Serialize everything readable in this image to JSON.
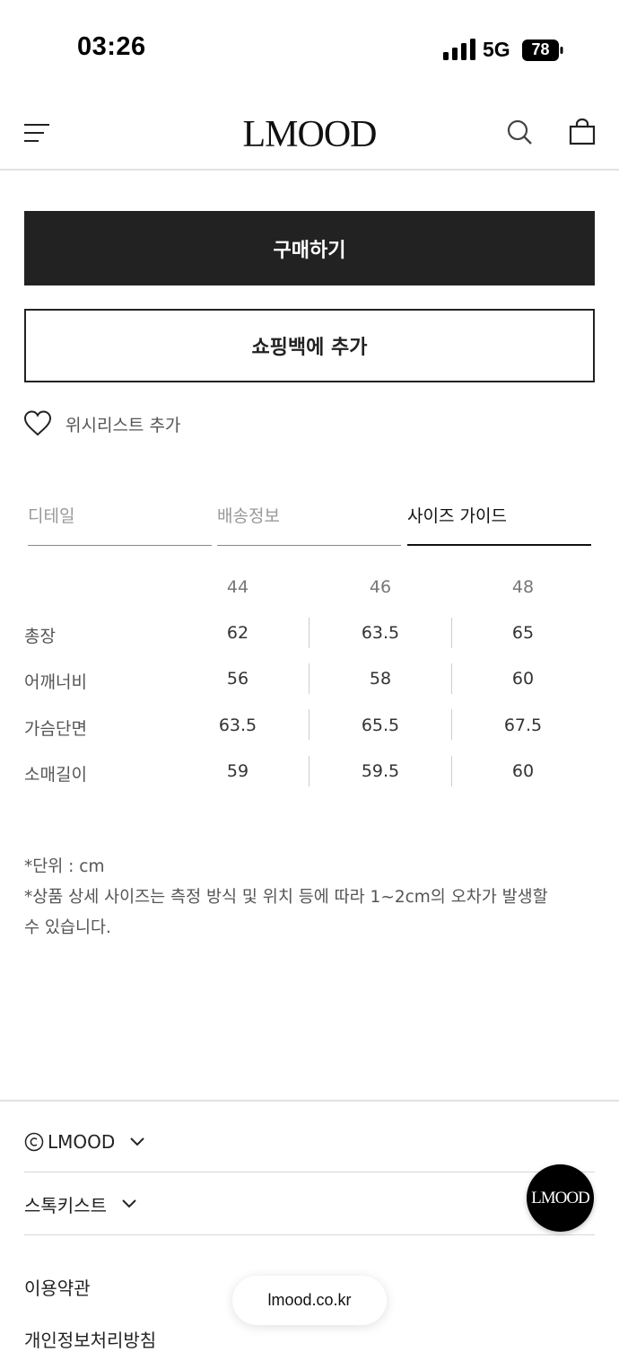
{
  "status_bar": {
    "time": "03:26",
    "network": "5G",
    "battery": "78"
  },
  "header": {
    "logo": "LMOOD",
    "menu_icon": "hamburger-menu-icon",
    "search_icon": "search-icon",
    "bag_icon": "shopping-bag-icon"
  },
  "actions": {
    "buy_label": "구매하기",
    "add_to_bag_label": "쇼핑백에 추가",
    "wishlist_label": "위시리스트 추가",
    "wishlist_icon": "heart-icon"
  },
  "tabs": [
    {
      "label": "디테일",
      "active": false
    },
    {
      "label": "배송정보",
      "active": false
    },
    {
      "label": "사이즈 가이드",
      "active": true
    }
  ],
  "size_table": {
    "sizes": [
      "44",
      "46",
      "48"
    ],
    "rows": [
      {
        "label": "총장",
        "values": [
          "62",
          "63.5",
          "65"
        ]
      },
      {
        "label": "어깨너비",
        "values": [
          "56",
          "58",
          "60"
        ]
      },
      {
        "label": "가슴단면",
        "values": [
          "63.5",
          "65.5",
          "67.5"
        ]
      },
      {
        "label": "소매길이",
        "values": [
          "59",
          "59.5",
          "60"
        ]
      }
    ]
  },
  "notes": {
    "unit": "*단위 : cm",
    "disclaimer_line1": "*상품 상세 사이즈는 측정 방식 및 위치 등에 따라 1~2cm의 오차가 발생할",
    "disclaimer_line2": "수 있습니다."
  },
  "footer": {
    "copyright_label": "LMOOD",
    "copyright_icon": "copyright-icon",
    "stockist_label": "스톡키스트",
    "terms_label": "이용약관",
    "privacy_label": "개인정보처리방침",
    "fab_label": "LMOOD",
    "url": "lmood.co.kr"
  }
}
